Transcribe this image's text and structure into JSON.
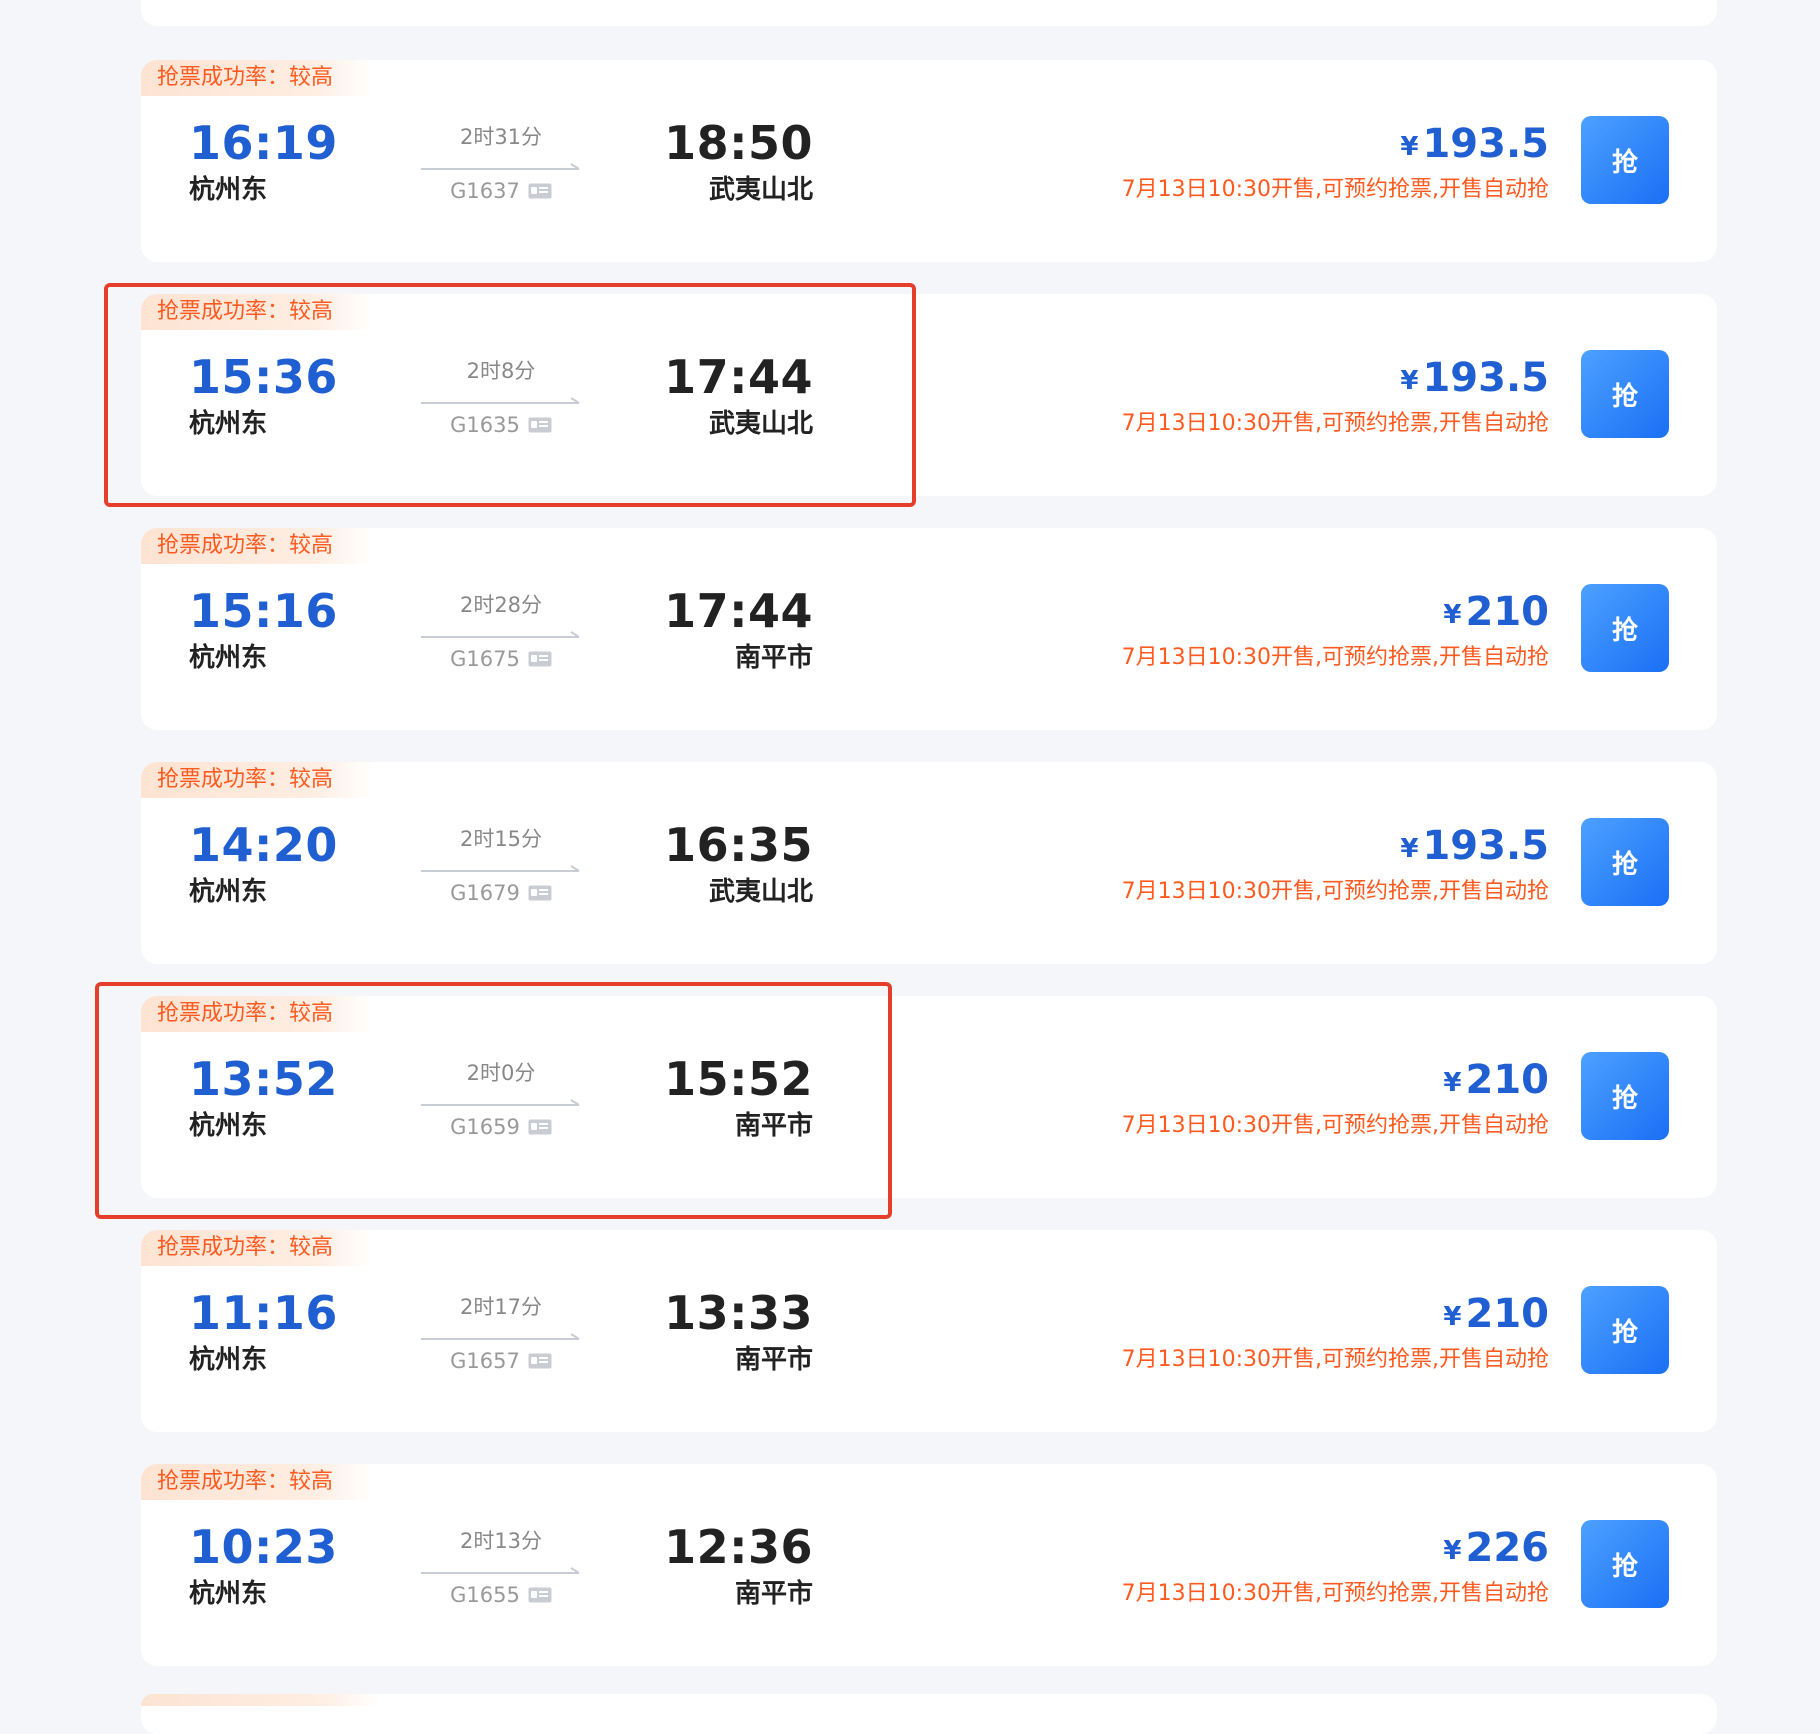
{
  "badge_text": "抢票成功率：较高",
  "grab_label": "抢",
  "trains": [
    {
      "dep_time": "16:19",
      "dep_station": "杭州东",
      "duration": "2时31分",
      "train_no": "G1637",
      "arr_time": "18:50",
      "arr_station": "武夷山北",
      "currency": "¥",
      "price": "193.5",
      "sale_note": "7月13日10:30开售,可预约抢票,开售自动抢"
    },
    {
      "dep_time": "15:36",
      "dep_station": "杭州东",
      "duration": "2时8分",
      "train_no": "G1635",
      "arr_time": "17:44",
      "arr_station": "武夷山北",
      "currency": "¥",
      "price": "193.5",
      "sale_note": "7月13日10:30开售,可预约抢票,开售自动抢"
    },
    {
      "dep_time": "15:16",
      "dep_station": "杭州东",
      "duration": "2时28分",
      "train_no": "G1675",
      "arr_time": "17:44",
      "arr_station": "南平市",
      "currency": "¥",
      "price": "210",
      "sale_note": "7月13日10:30开售,可预约抢票,开售自动抢"
    },
    {
      "dep_time": "14:20",
      "dep_station": "杭州东",
      "duration": "2时15分",
      "train_no": "G1679",
      "arr_time": "16:35",
      "arr_station": "武夷山北",
      "currency": "¥",
      "price": "193.5",
      "sale_note": "7月13日10:30开售,可预约抢票,开售自动抢"
    },
    {
      "dep_time": "13:52",
      "dep_station": "杭州东",
      "duration": "2时0分",
      "train_no": "G1659",
      "arr_time": "15:52",
      "arr_station": "南平市",
      "currency": "¥",
      "price": "210",
      "sale_note": "7月13日10:30开售,可预约抢票,开售自动抢"
    },
    {
      "dep_time": "11:16",
      "dep_station": "杭州东",
      "duration": "2时17分",
      "train_no": "G1657",
      "arr_time": "13:33",
      "arr_station": "南平市",
      "currency": "¥",
      "price": "210",
      "sale_note": "7月13日10:30开售,可预约抢票,开售自动抢"
    },
    {
      "dep_time": "10:23",
      "dep_station": "杭州东",
      "duration": "2时13分",
      "train_no": "G1655",
      "arr_time": "12:36",
      "arr_station": "南平市",
      "currency": "¥",
      "price": "226",
      "sale_note": "7月13日10:30开售,可预约抢票,开售自动抢"
    }
  ],
  "highlighted_trains": [
    "G1635",
    "G1659"
  ],
  "colors": {
    "departure_blue": "#1f5fd1",
    "accent_orange": "#ff5a1f",
    "highlight_red": "#e53e2b",
    "button_blue": "#1a6ff5"
  }
}
